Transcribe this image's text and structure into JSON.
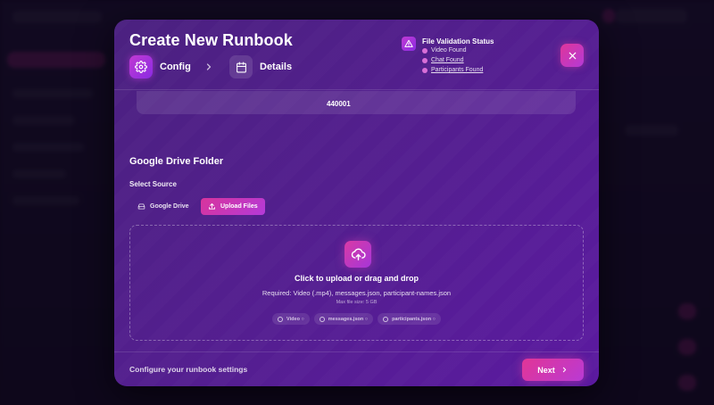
{
  "modal": {
    "title": "Create New Runbook",
    "steps": [
      {
        "label": "Config",
        "icon": "gear-icon",
        "active": true
      },
      {
        "label": "Details",
        "icon": "calendar-icon",
        "active": false
      }
    ],
    "validation": {
      "title": "File Validation Status",
      "items": [
        {
          "label": "Video Found",
          "link": false
        },
        {
          "label": "Chat Found",
          "link": true
        },
        {
          "label": "Participants Found",
          "link": true
        }
      ]
    },
    "previous_value": "440001",
    "section_title": "Google Drive Folder",
    "select_source_label": "Select Source",
    "sources": [
      {
        "label": "Google Drive",
        "icon": "drive-icon",
        "selected": false
      },
      {
        "label": "Upload Files",
        "icon": "upload-icon",
        "selected": true
      }
    ],
    "dropzone": {
      "title": "Click to upload or drag and drop",
      "required": "Required: Video (.mp4), messages.json, participant-names.json",
      "max_size": "Max file size: 5 GB",
      "chips": [
        "Video ○",
        "messages.json ○",
        "participants.json ○"
      ]
    },
    "footer_text": "Configure your runbook settings",
    "next_label": "Next"
  },
  "colors": {
    "accent_pink": "#e23596",
    "accent_purple": "#b93ad4",
    "modal_bg": "#531f8e"
  }
}
